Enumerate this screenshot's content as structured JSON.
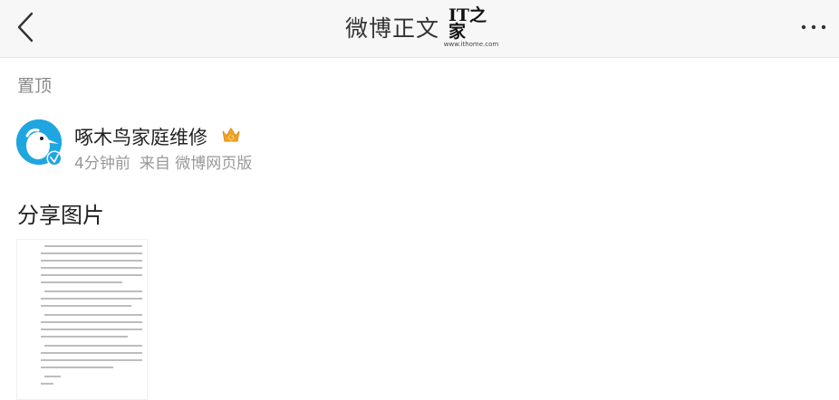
{
  "header": {
    "title": "微博正文",
    "logo_mark": "IT之家",
    "logo_url": "www.ithome.com"
  },
  "pin_label": "置顶",
  "post": {
    "author": "啄木鸟家庭维修",
    "time_ago": "4分钟前",
    "source": "来自 微博网页版",
    "text": "分享图片"
  },
  "icons": {
    "back": "chevron-left-icon",
    "more": "more-horizontal-icon",
    "verified": "verified-badge-icon",
    "vip": "crown-badge-icon"
  },
  "colors": {
    "avatar_bg": "#1fa5e0",
    "meta_text": "#999999",
    "vip_gold": "#f5a623"
  }
}
